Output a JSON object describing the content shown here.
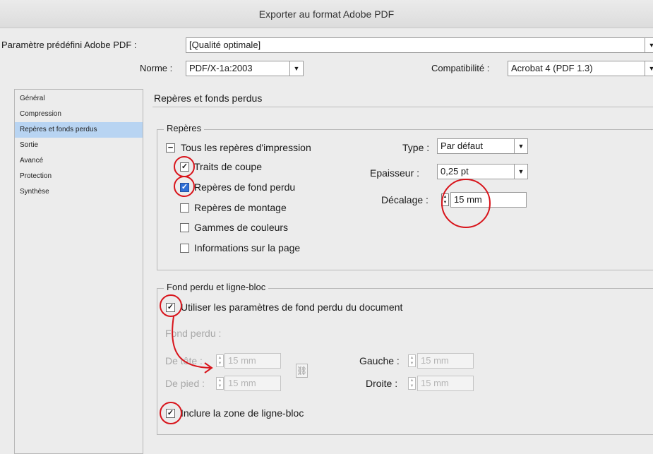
{
  "window": {
    "title": "Exporter au format Adobe PDF"
  },
  "preset": {
    "label": "Paramètre prédéfini Adobe PDF :",
    "value": "[Qualité optimale]"
  },
  "standard": {
    "label": "Norme :",
    "value": "PDF/X-1a:2003"
  },
  "compat": {
    "label": "Compatibilité :",
    "value": "Acrobat 4 (PDF 1.3)"
  },
  "sidebar": {
    "items": [
      {
        "label": "Général"
      },
      {
        "label": "Compression"
      },
      {
        "label": "Repères et fonds perdus",
        "selected": true
      },
      {
        "label": "Sortie"
      },
      {
        "label": "Avancé"
      },
      {
        "label": "Protection"
      },
      {
        "label": "Synthèse"
      }
    ]
  },
  "main": {
    "section_title": "Repères et fonds perdus",
    "marks": {
      "legend": "Repères",
      "all_label": "Tous les repères d'impression",
      "items": [
        {
          "label": "Traits de coupe",
          "checked": true
        },
        {
          "label": "Repères de fond perdu",
          "checked": true
        },
        {
          "label": "Repères de montage",
          "checked": false
        },
        {
          "label": "Gammes de couleurs",
          "checked": false
        },
        {
          "label": "Informations sur la page",
          "checked": false
        }
      ],
      "type": {
        "label": "Type :",
        "value": "Par défaut"
      },
      "weight": {
        "label": "Epaisseur :",
        "value": "0,25 pt"
      },
      "offset": {
        "label": "Décalage :",
        "value": "15 mm"
      }
    },
    "bleed": {
      "legend": "Fond perdu et ligne-bloc",
      "use_doc_label": "Utiliser les paramètres de fond perdu du document",
      "bleed_label": "Fond perdu :",
      "top": {
        "label": "De tête :",
        "value": "15 mm"
      },
      "bottom": {
        "label": "De pied :",
        "value": "15 mm"
      },
      "left": {
        "label": "Gauche :",
        "value": "15 mm"
      },
      "right": {
        "label": "Droite :",
        "value": "15 mm"
      },
      "slug_label": "Inclure la zone de ligne-bloc"
    }
  },
  "colors": {
    "annotation": "#d8141b",
    "selected": "#b8d4f2",
    "checked_blue": "#2f6fd6"
  }
}
